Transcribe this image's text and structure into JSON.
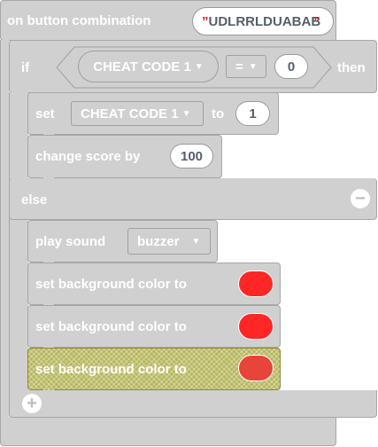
{
  "event_block": {
    "label": "on button combination",
    "combo_value": "UDLRRLDUABAB",
    "quote_open": "”",
    "quote_close": "”"
  },
  "if_block": {
    "if_label": "if",
    "then_label": "then",
    "else_label": "else",
    "condition": {
      "variable": "CHEAT CODE 1",
      "operator": "=",
      "value": "0"
    }
  },
  "then_blocks": {
    "set": {
      "label": "set",
      "variable": "CHEAT CODE 1",
      "to_label": "to",
      "value": "1"
    },
    "change_score": {
      "label": "change score by",
      "value": "100"
    }
  },
  "else_blocks": {
    "play_sound": {
      "label": "play sound",
      "sound": "buzzer"
    },
    "bg_colors": [
      {
        "label": "set background color to",
        "color": "#ff2626"
      },
      {
        "label": "set background color to",
        "color": "#ff2626"
      },
      {
        "label": "set background color to",
        "color": "#ff2626"
      }
    ]
  },
  "icons": {
    "dropdown": "▼",
    "minus": "−",
    "plus": "+"
  }
}
